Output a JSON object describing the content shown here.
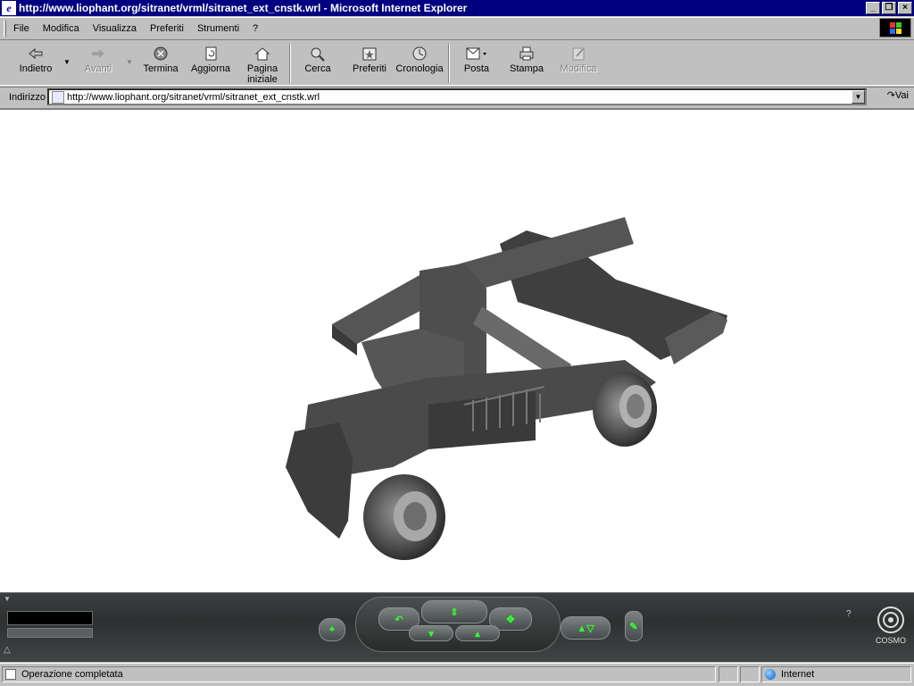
{
  "window": {
    "title": "http://www.liophant.org/sitranet/vrml/sitranet_ext_cnstk.wrl - Microsoft Internet Explorer"
  },
  "menu": [
    "File",
    "Modifica",
    "Visualizza",
    "Preferiti",
    "Strumenti",
    "?"
  ],
  "toolbar": {
    "back": "Indietro",
    "forward": "Avanti",
    "stop": "Termina",
    "refresh": "Aggiorna",
    "home_line1": "Pagina",
    "home_line2": "iniziale",
    "search": "Cerca",
    "favorites": "Preferiti",
    "history": "Cronologia",
    "mail": "Posta",
    "print": "Stampa",
    "edit": "Modifica"
  },
  "address": {
    "label": "Indirizzo",
    "value": "http://www.liophant.org/sitranet/vrml/sitranet_ext_cnstk.wrl",
    "go": "Vai"
  },
  "cosmo": {
    "logo": "COSMO",
    "help": "?"
  },
  "status": {
    "text": "Operazione completata",
    "zone": "Internet"
  },
  "colors": {
    "titlebar": "#000080",
    "chrome": "#c0c0c0",
    "model": "#4a4a4a",
    "cosmo_panel": "#353838",
    "cosmo_accent": "#2cff2c"
  }
}
